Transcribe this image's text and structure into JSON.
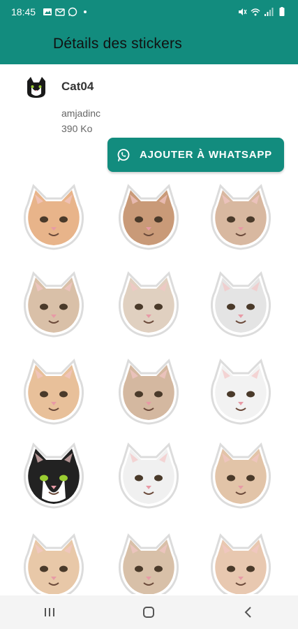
{
  "status": {
    "time": "18:45"
  },
  "appbar": {
    "title": "Détails des stickers"
  },
  "pack": {
    "name": "Cat04",
    "author": "amjadinc",
    "size": "390 Ko",
    "add_label": "AJOUTER À WHATSAPP"
  },
  "colors": {
    "accent": "#128C7E",
    "tray_accent": "#000000"
  },
  "stickers": [
    {
      "name": "sticker-cat-laughing",
      "fur": "#e8b48a",
      "bg": "#ffffff"
    },
    {
      "name": "sticker-cat-squint",
      "fur": "#c99a78",
      "bg": "#ffffff"
    },
    {
      "name": "sticker-cat-smile",
      "fur": "#d8b8a0",
      "bg": "#ffffff"
    },
    {
      "name": "sticker-cat-tongue",
      "fur": "#d9c0a8",
      "bg": "#ffffff"
    },
    {
      "name": "sticker-cat-top-hat",
      "fur": "#e0d0c0",
      "bg": "#ffffff"
    },
    {
      "name": "sticker-cat-sitting",
      "fur": "#e4e4e4",
      "bg": "#ffffff"
    },
    {
      "name": "sticker-cat-shout",
      "fur": "#e8c09a",
      "bg": "#ffffff"
    },
    {
      "name": "sticker-cat-smirk",
      "fur": "#d4b8a0",
      "bg": "#ffffff"
    },
    {
      "name": "sticker-cat-looking-up",
      "fur": "#f2f2f2",
      "bg": "#ffffff"
    },
    {
      "name": "sticker-cat-tuxedo",
      "fur": "#222222",
      "bg": "#ffffff"
    },
    {
      "name": "sticker-cat-surprised",
      "fur": "#f0f0f0",
      "bg": "#ffffff"
    },
    {
      "name": "sticker-cat-bowtie",
      "fur": "#e2c4a8",
      "bg": "#ffffff"
    },
    {
      "name": "sticker-cat-blue-hat",
      "fur": "#e8c8a8",
      "bg": "#ffffff"
    },
    {
      "name": "sticker-cat-grumpy",
      "fur": "#d8c0a8",
      "bg": "#ffffff"
    },
    {
      "name": "sticker-cat-bow-pink",
      "fur": "#e8c8b0",
      "bg": "#ffffff"
    }
  ]
}
